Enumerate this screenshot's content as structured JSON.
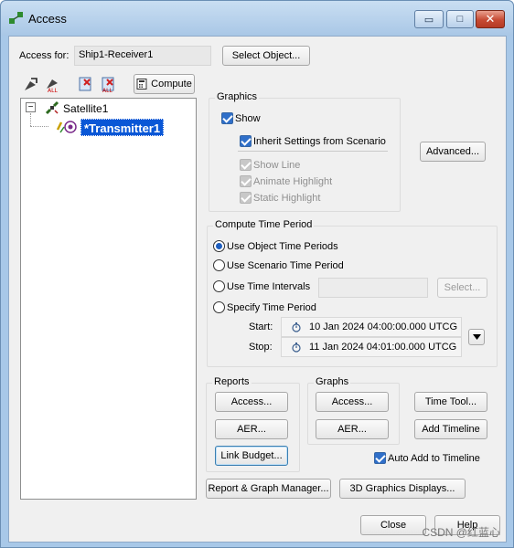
{
  "window": {
    "title": "Access",
    "minimize_glyph": "▭",
    "maximize_glyph": "□",
    "close_glyph": "✕"
  },
  "access_for": {
    "label": "Access for:",
    "value": "Ship1-Receiver1",
    "select_button": "Select Object..."
  },
  "toolbar": {
    "compute_label": "Compute"
  },
  "tree": {
    "expander": "−",
    "root_label": "Satellite1",
    "child_label": "*Transmitter1"
  },
  "graphics": {
    "title": "Graphics",
    "show_label": "Show",
    "inherit_label": "Inherit Settings from Scenario",
    "show_line_label": "Show Line",
    "animate_highlight_label": "Animate Highlight",
    "static_highlight_label": "Static Highlight",
    "advanced_button": "Advanced..."
  },
  "compute_time": {
    "title": "Compute Time Period",
    "opt_object": "Use Object Time Periods",
    "opt_scenario": "Use Scenario Time Period",
    "opt_intervals": "Use Time Intervals",
    "intervals_select_button": "Select...",
    "opt_specify": "Specify Time Period",
    "start_label": "Start:",
    "start_value": "10 Jan 2024 04:00:00.000 UTCG",
    "stop_label": "Stop:",
    "stop_value": "11 Jan 2024 04:01:00.000 UTCG"
  },
  "reports": {
    "title": "Reports",
    "access_button": "Access...",
    "aer_button": "AER...",
    "link_budget_button": "Link Budget..."
  },
  "graphs": {
    "title": "Graphs",
    "access_button": "Access...",
    "aer_button": "AER..."
  },
  "side": {
    "time_tool_button": "Time Tool...",
    "add_timeline_button": "Add Timeline",
    "auto_add_label": "Auto Add to Timeline"
  },
  "bottom": {
    "report_graph_manager_button": "Report & Graph Manager...",
    "graphics_displays_button": "3D Graphics Displays...",
    "close_button": "Close",
    "help_button": "Help"
  },
  "watermark": "CSDN @红蓝心",
  "colors": {
    "accent": "#2f6fc9",
    "selection": "#0a57d6",
    "titlebar": "#b4d0ec"
  }
}
